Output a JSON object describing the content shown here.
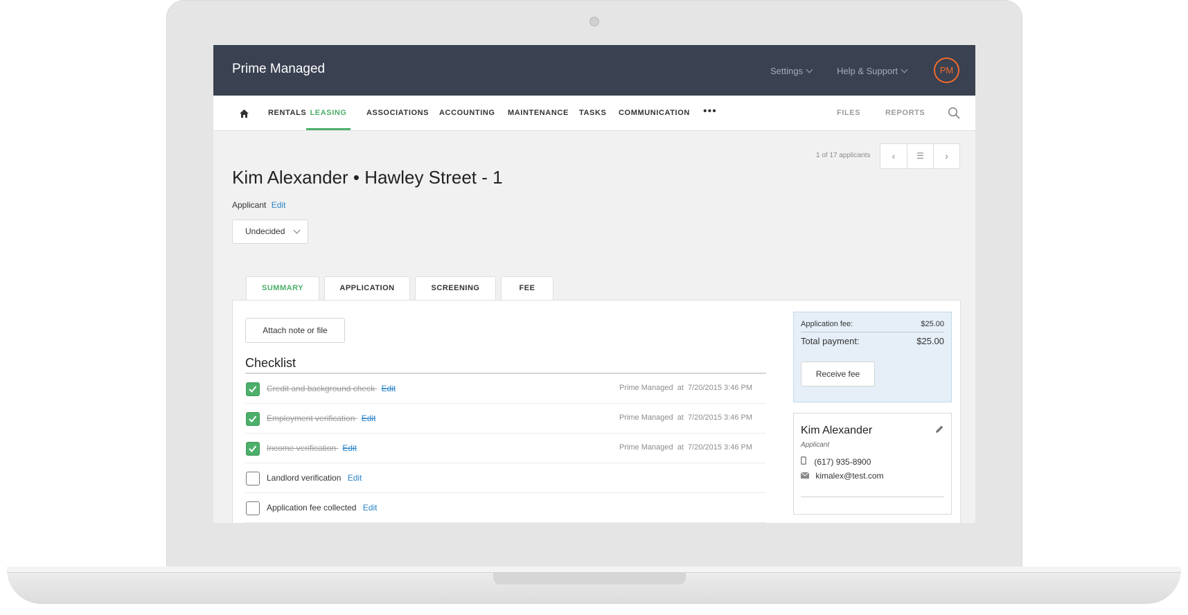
{
  "app": {
    "title": "Prime Managed"
  },
  "topbar": {
    "settings_label": "Settings",
    "help_label": "Help & Support",
    "avatar_initials": "PM",
    "accent_color": "#ef6b2e"
  },
  "nav": {
    "items": [
      {
        "label": "RENTALS"
      },
      {
        "label": "LEASING",
        "active": true
      },
      {
        "label": "ASSOCIATIONS"
      },
      {
        "label": "ACCOUNTING"
      },
      {
        "label": "MAINTENANCE"
      },
      {
        "label": "TASKS"
      },
      {
        "label": "COMMUNICATION"
      }
    ],
    "more_label": "•••",
    "right_items": [
      {
        "label": "FILES"
      },
      {
        "label": "REPORTS"
      }
    ],
    "active_color": "#4caf6a",
    "icons": {
      "home": "home-icon",
      "search": "search-icon",
      "more": "more-icon"
    }
  },
  "pager": {
    "text": "1 of 17 applicants",
    "prev": "‹",
    "list": "☰",
    "next": "›"
  },
  "page": {
    "title": "Kim Alexander • Hawley Street - 1",
    "role": "Applicant",
    "edit_label": "Edit",
    "status_value": "Undecided"
  },
  "tabs": [
    {
      "label": "SUMMARY",
      "active": true
    },
    {
      "label": "APPLICATION"
    },
    {
      "label": "SCREENING"
    },
    {
      "label": "FEE"
    }
  ],
  "summary": {
    "attach_label": "Attach note or file",
    "checklist_title": "Checklist",
    "checklist": [
      {
        "label": "Credit and background check",
        "done": true,
        "edit": "Edit",
        "by": "Prime Managed",
        "at": "at",
        "when": "7/20/2015 3:46 PM"
      },
      {
        "label": "Employment verification",
        "done": true,
        "edit": "Edit",
        "by": "Prime Managed",
        "at": "at",
        "when": "7/20/2015 3:46 PM"
      },
      {
        "label": "Income verification",
        "done": true,
        "edit": "Edit",
        "by": "Prime Managed",
        "at": "at",
        "when": "7/20/2015 3:46 PM"
      },
      {
        "label": "Landlord verification",
        "done": false,
        "edit": "Edit"
      },
      {
        "label": "Application fee collected",
        "done": false,
        "edit": "Edit"
      }
    ],
    "fee": {
      "fee_label": "Application fee:",
      "fee_value": "$25.00",
      "total_label": "Total payment:",
      "total_value": "$25.00",
      "receive_label": "Receive fee"
    },
    "contact": {
      "name": "Kim Alexander",
      "role": "Applicant",
      "phone": "(617) 935-8900",
      "email": "kimalex@test.com",
      "icons": {
        "edit": "pencil-icon",
        "phone": "phone-icon",
        "email": "mail-icon"
      }
    }
  }
}
